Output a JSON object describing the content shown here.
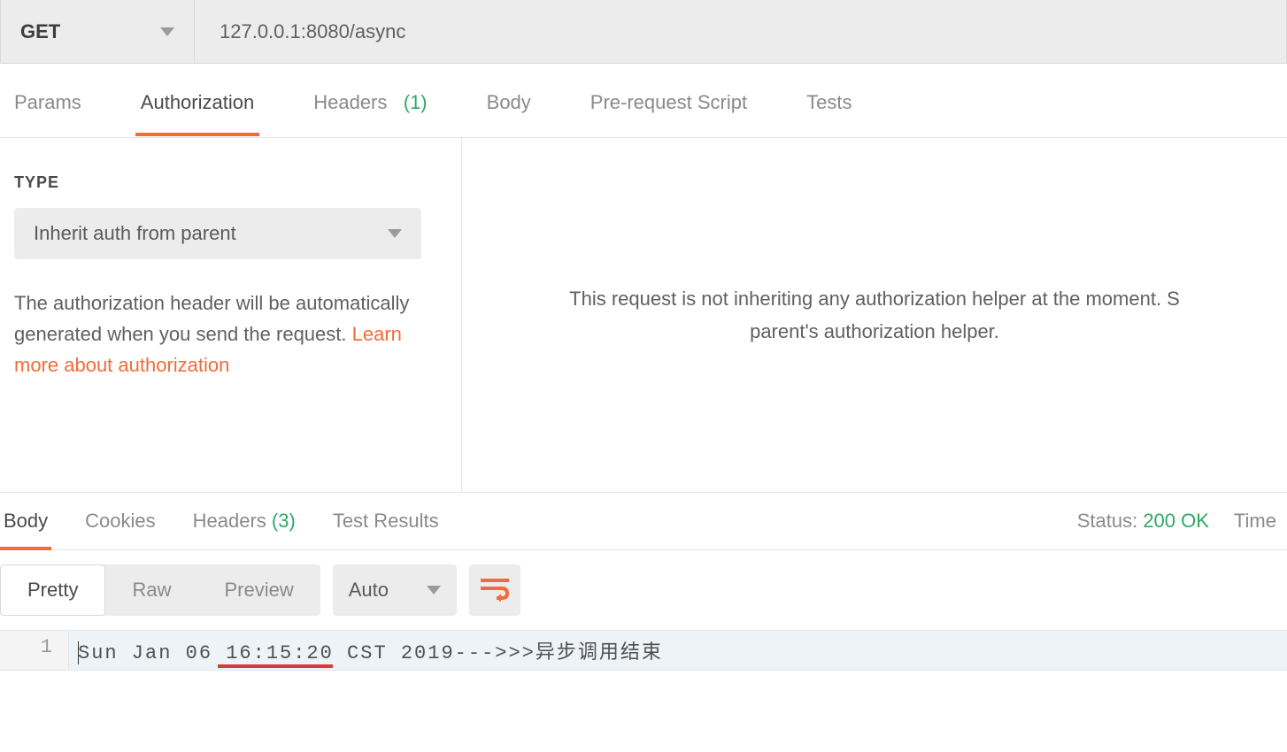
{
  "request": {
    "method": "GET",
    "url": "127.0.0.1:8080/async"
  },
  "request_tabs": {
    "params": "Params",
    "authorization": "Authorization",
    "headers_label": "Headers",
    "headers_count": "(1)",
    "body": "Body",
    "prerequest": "Pre-request Script",
    "tests": "Tests"
  },
  "auth": {
    "type_label": "TYPE",
    "type_value": "Inherit auth from parent",
    "desc_prefix": "The authorization header will be automatically generated when you send the request. ",
    "link_text": "Learn more about authorization",
    "right_line1": "This request is not inheriting any authorization helper at the moment. S",
    "right_line2": "parent's authorization helper."
  },
  "response_tabs": {
    "body": "Body",
    "cookies": "Cookies",
    "headers_label": "Headers",
    "headers_count": "(3)",
    "test_results": "Test Results"
  },
  "response_status": {
    "status_label": "Status:",
    "status_value": "200 OK",
    "time_label": "Time"
  },
  "body_view": {
    "pretty": "Pretty",
    "raw": "Raw",
    "preview": "Preview",
    "auto": "Auto"
  },
  "response_body": {
    "line_no": "1",
    "line": "Sun Jan 06 16:15:20 CST 2019--->>>异步调用结束"
  }
}
